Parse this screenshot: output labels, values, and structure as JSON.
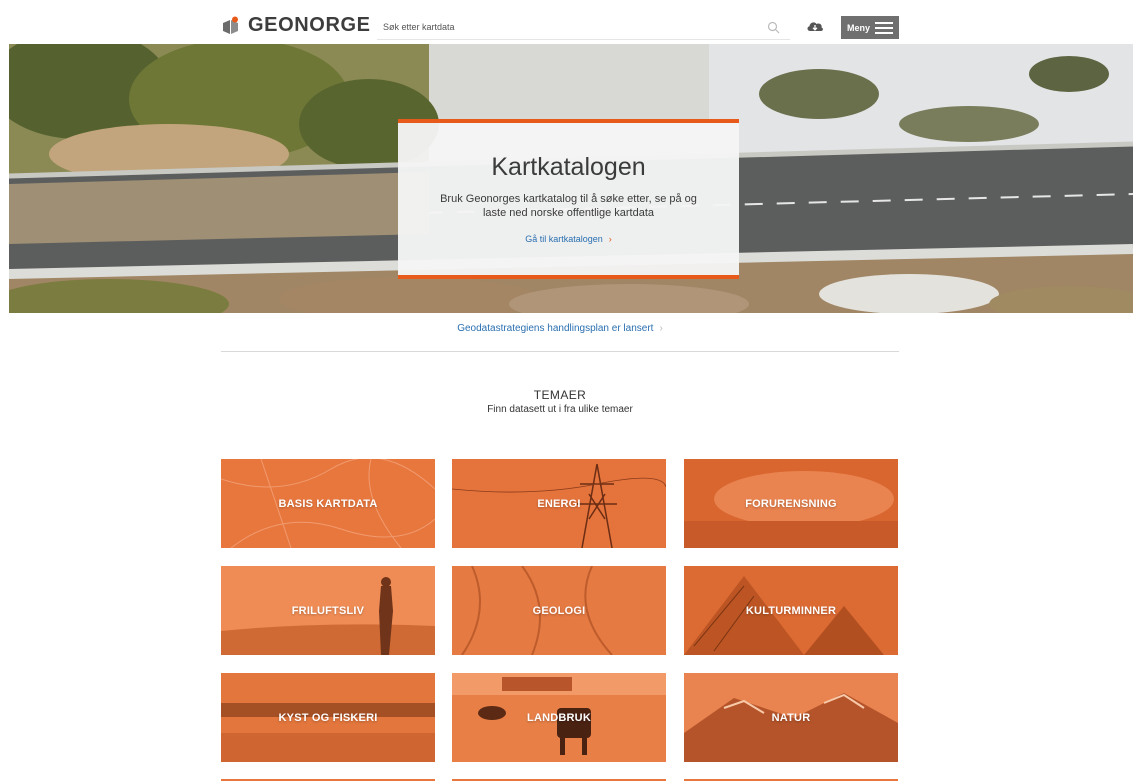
{
  "header": {
    "logo_text": "GEONORGE",
    "search_placeholder": "Søk etter kartdata",
    "menu_label": "Meny"
  },
  "hero": {
    "title": "Kartkatalogen",
    "description": "Bruk Geonorges kartkatalog til å søke etter, se på og laste ned norske offentlige kartdata",
    "link_label": "Gå til kartkatalogen",
    "link_chevron": "›"
  },
  "announcement": {
    "text": "Geodatastrategiens handlingsplan er lansert",
    "chevron": "›"
  },
  "themes": {
    "heading": "TEMAER",
    "subheading": "Finn datasett ut i fra ulike temaer",
    "items": [
      {
        "label": "BASIS KARTDATA"
      },
      {
        "label": "ENERGI"
      },
      {
        "label": "FORURENSNING"
      },
      {
        "label": "FRILUFTSLIV"
      },
      {
        "label": "GEOLOGI"
      },
      {
        "label": "KULTURMINNER"
      },
      {
        "label": "KYST OG FISKERI"
      },
      {
        "label": "LANDBRUK"
      },
      {
        "label": "NATUR"
      }
    ]
  },
  "colors": {
    "accent": "#e85a19",
    "tile": "#e8773e",
    "link": "#2a6fb0",
    "menu_bg": "#6f6f6f"
  }
}
